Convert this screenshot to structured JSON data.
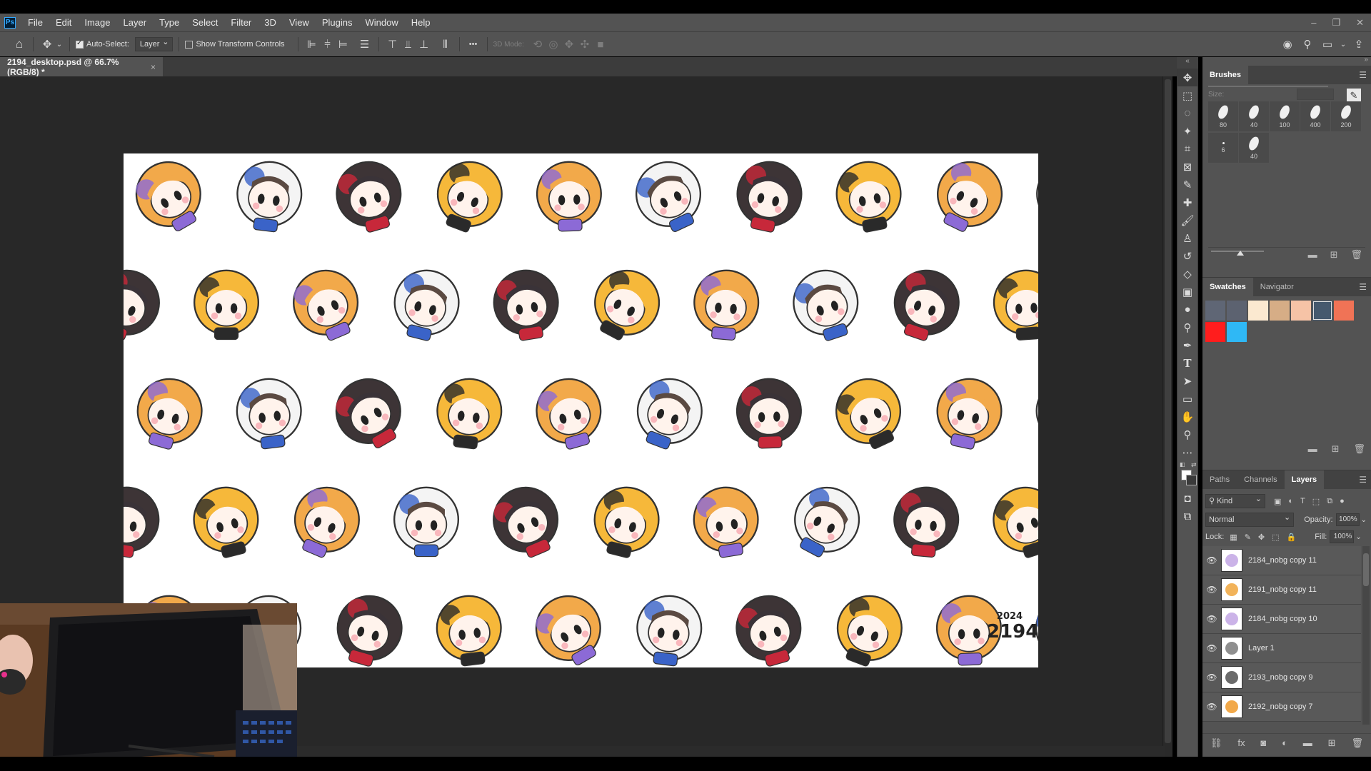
{
  "app": {
    "logo": "Ps"
  },
  "menu": [
    "File",
    "Edit",
    "Image",
    "Layer",
    "Type",
    "Select",
    "Filter",
    "3D",
    "View",
    "Plugins",
    "Window",
    "Help"
  ],
  "window_controls": {
    "minimize": "–",
    "restore": "❐",
    "close": "✕"
  },
  "options_bar": {
    "auto_select_label": "Auto-Select:",
    "auto_select_checked": true,
    "auto_select_target": "Layer",
    "transform_label": "Show Transform Controls",
    "transform_checked": false,
    "more_label": "•••",
    "mode_3d_label": "3D Mode:"
  },
  "document": {
    "tab_title": "2194_desktop.psd @ 66.7% (RGB/8) *",
    "close_label": "×",
    "signature_line1": "2024",
    "signature_line2": "2194"
  },
  "brushes": {
    "title": "Brushes",
    "size_label": "Size:",
    "presets": [
      {
        "size": "80",
        "small": false
      },
      {
        "size": "40",
        "small": false
      },
      {
        "size": "100",
        "small": false
      },
      {
        "size": "400",
        "small": false
      },
      {
        "size": "200",
        "small": false
      },
      {
        "size": "6",
        "small": true
      },
      {
        "size": "40",
        "small": false
      }
    ]
  },
  "swatches": {
    "tabs": [
      "Swatches",
      "Navigator"
    ],
    "colors": [
      "#5f6675",
      "#5c6270",
      "#fbe9d0",
      "#d6ad86",
      "#f6c3a6",
      "#45596e",
      "#f07356",
      "#ff1d1d",
      "#2fb8f5"
    ],
    "selected_index": 5
  },
  "layers": {
    "tabs": [
      "Paths",
      "Channels",
      "Layers"
    ],
    "kind_label": "Kind",
    "blend_mode": "Normal",
    "opacity_label": "Opacity:",
    "opacity_value": "100%",
    "lock_label": "Lock:",
    "fill_label": "Fill:",
    "fill_value": "100%",
    "items": [
      {
        "name": "2184_nobg copy 11",
        "color": "#cbb3e8"
      },
      {
        "name": "2191_nobg copy 11",
        "color": "#f2b35a"
      },
      {
        "name": "2184_nobg copy 10",
        "color": "#cbb3e8"
      },
      {
        "name": "Layer 1",
        "color": "#8f8f8f"
      },
      {
        "name": "2193_nobg copy 9",
        "color": "#6b6b6b"
      },
      {
        "name": "2192_nobg copy 7",
        "color": "#f2a94a"
      }
    ]
  }
}
